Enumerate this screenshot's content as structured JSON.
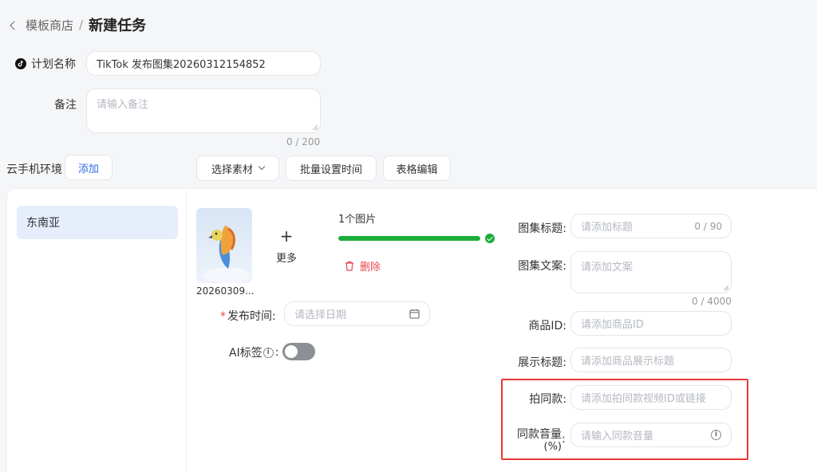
{
  "header": {
    "crumb": "模板商店",
    "separator": "/",
    "title": "新建任务"
  },
  "plan": {
    "label": "计划名称",
    "value": "TikTok 发布图集20260312154852"
  },
  "remark": {
    "label": "备注",
    "placeholder": "请输入备注",
    "counter": "0 / 200"
  },
  "env": {
    "label": "云手机环境",
    "add_label": "添加"
  },
  "toolbar": {
    "select_material": "选择素材",
    "batch_time": "批量设置时间",
    "table_edit": "表格编辑"
  },
  "regions": [
    {
      "label": "东南亚"
    }
  ],
  "media": {
    "more_label": "更多",
    "plus": "+",
    "thumb_name": "20260309...",
    "image_count": "1个图片",
    "progress": 1.0,
    "delete_label": "删除"
  },
  "publish": {
    "required_mark": "*",
    "label": "发布时间",
    "colon": ":",
    "placeholder": "请选择日期"
  },
  "ai_tag": {
    "label": "AI标签",
    "colon": ":",
    "enabled": false
  },
  "fields": {
    "album_title": {
      "label": "图集标题:",
      "placeholder": "请添加标题",
      "counter": "0 / 90"
    },
    "album_text": {
      "label": "图集文案:",
      "placeholder": "请添加文案",
      "counter": "0 / 4000"
    },
    "product_id": {
      "label": "商品ID:",
      "placeholder": "请添加商品ID"
    },
    "display_title": {
      "label": "展示标题:",
      "placeholder": "请添加商品展示标题"
    },
    "same_video": {
      "label": "拍同款:",
      "placeholder": "请添加拍同款视频ID或链接"
    },
    "same_volume": {
      "label1": "同款音量",
      "label2": "(%)",
      "colon": ":",
      "placeholder": "请输入同款音量"
    }
  },
  "colors": {
    "accent": "#2f6fe8",
    "success": "#1aad3a",
    "danger": "#e5484d",
    "highlight": "#e53935"
  }
}
